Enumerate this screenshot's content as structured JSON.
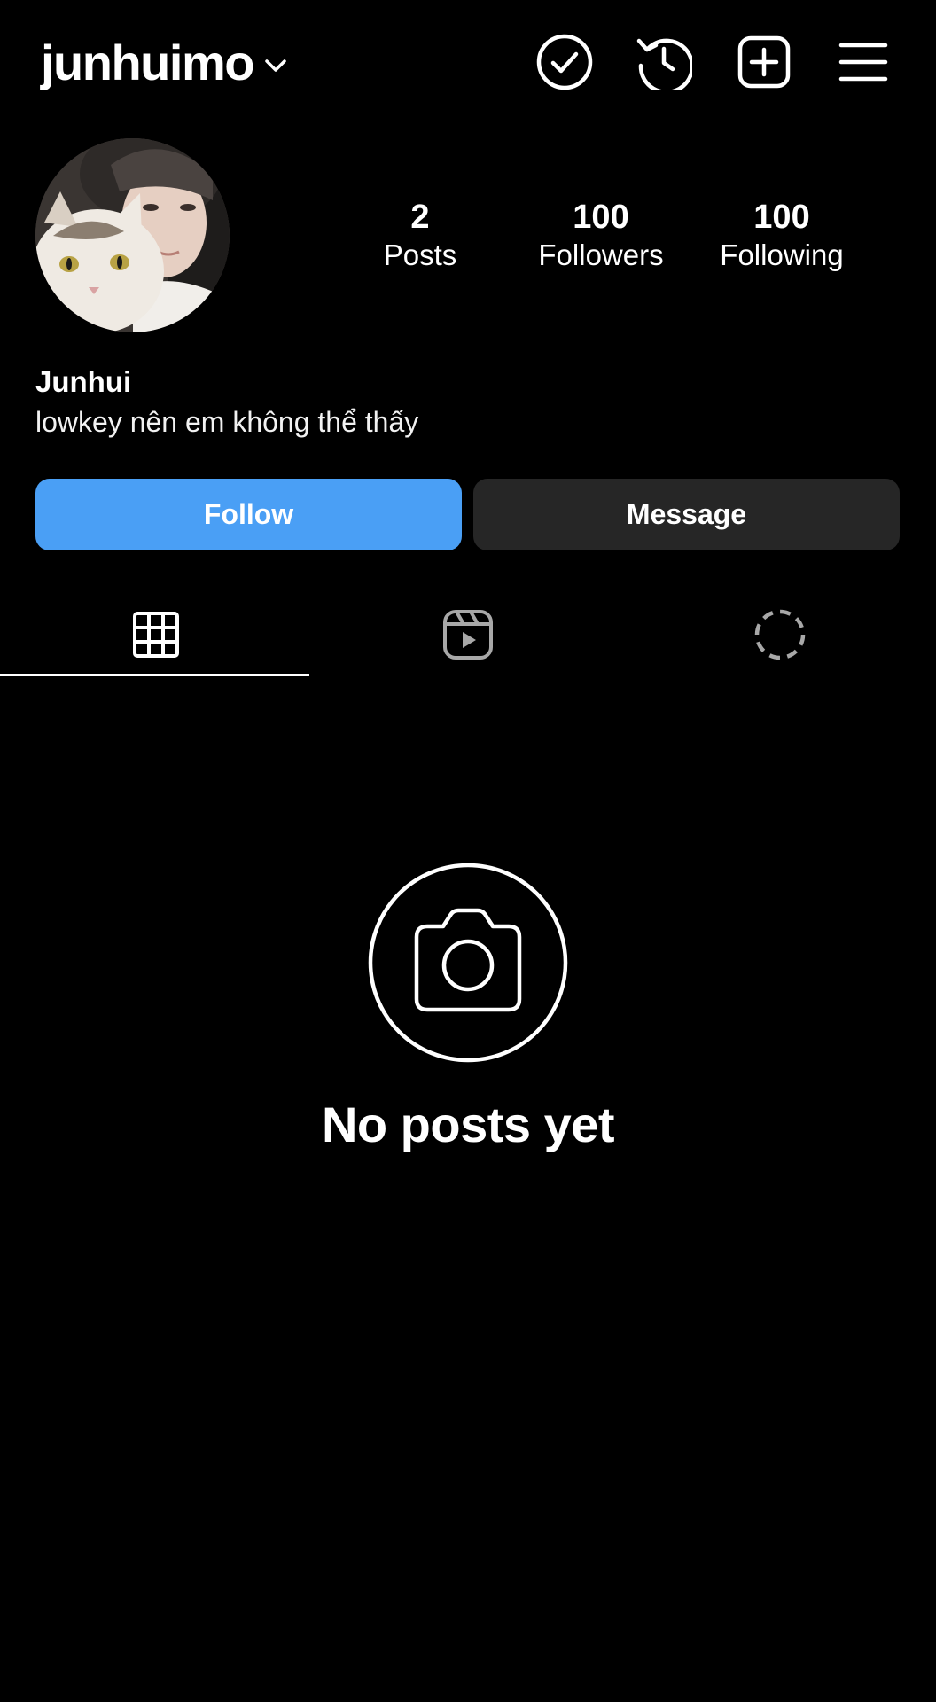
{
  "header": {
    "username": "junhuimo",
    "icons": [
      "verified-check-icon",
      "history-icon",
      "new-post-icon",
      "menu-icon"
    ]
  },
  "profile": {
    "stats": [
      {
        "value": "2",
        "label": "Posts"
      },
      {
        "value": "100",
        "label": "Followers"
      },
      {
        "value": "100",
        "label": "Following"
      }
    ],
    "display_name": "Junhui",
    "bio": "lowkey nên em không thể thấy"
  },
  "actions": {
    "follow_label": "Follow",
    "message_label": "Message"
  },
  "tabs": [
    {
      "icon": "grid-icon",
      "active": true
    },
    {
      "icon": "reels-icon",
      "active": false
    },
    {
      "icon": "tagged-icon",
      "active": false
    }
  ],
  "empty_state": {
    "title": "No posts yet",
    "icon": "camera-icon"
  },
  "colors": {
    "background": "#000000",
    "follow_button": "#4a9ff5",
    "message_button": "#262626",
    "text": "#ffffff"
  }
}
